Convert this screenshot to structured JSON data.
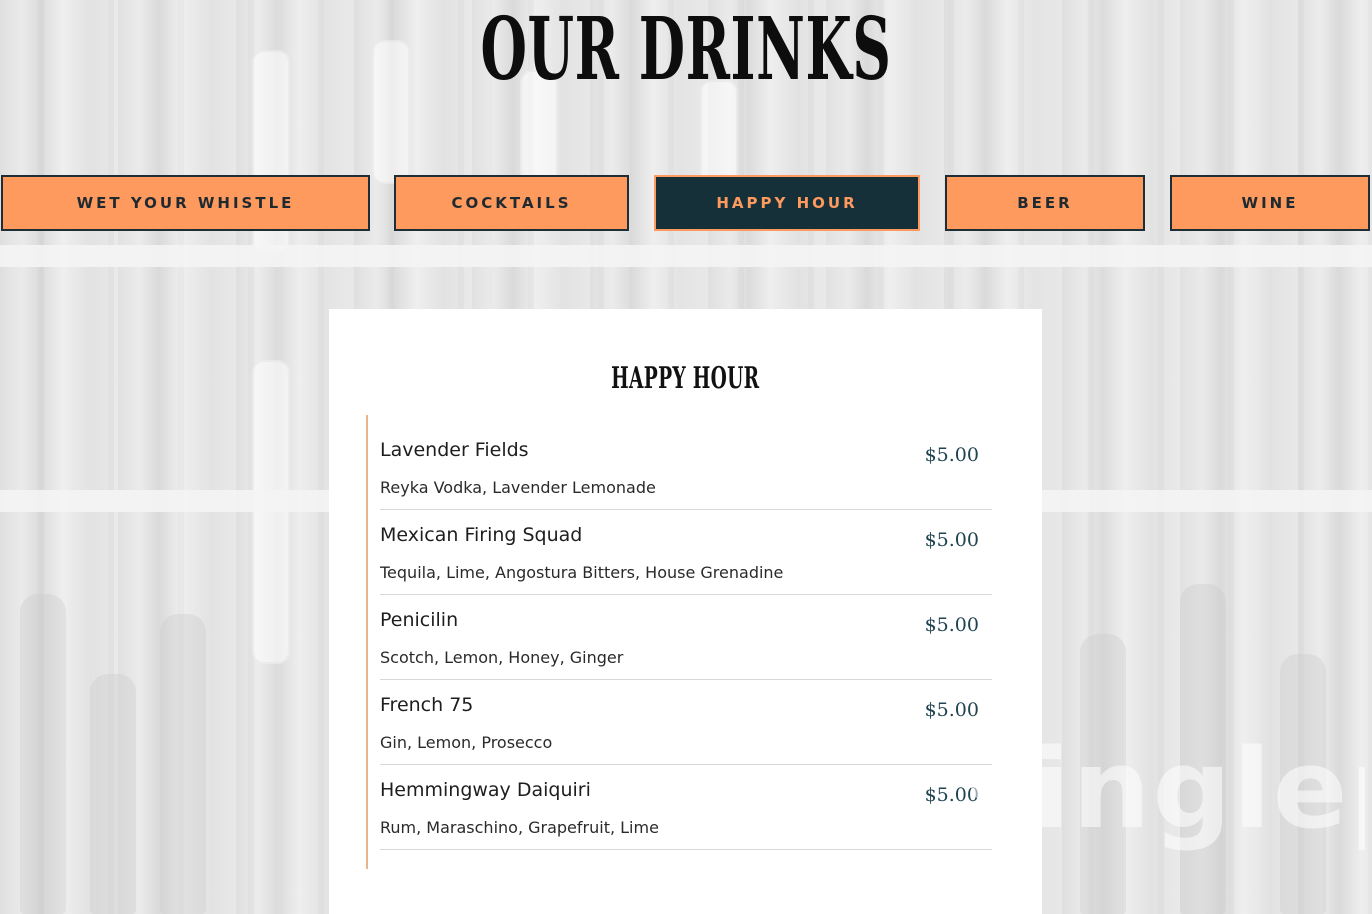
{
  "page": {
    "title": "OUR DRINKS"
  },
  "tabs": [
    {
      "label": "WET YOUR WHISTLE",
      "active": false
    },
    {
      "label": "COCKTAILS",
      "active": false
    },
    {
      "label": "HAPPY HOUR",
      "active": true
    },
    {
      "label": "BEER",
      "active": false
    },
    {
      "label": "WINE",
      "active": false
    }
  ],
  "menu": {
    "section_title": "HAPPY HOUR",
    "items": [
      {
        "name": "Lavender Fields",
        "description": "Reyka Vodka, Lavender Lemonade",
        "price": "$5.00"
      },
      {
        "name": "Mexican Firing Squad",
        "description": "Tequila, Lime, Angostura Bitters, House Grenadine",
        "price": "$5.00"
      },
      {
        "name": "Penicilin",
        "description": "Scotch, Lemon, Honey, Ginger",
        "price": "$5.00"
      },
      {
        "name": "French 75",
        "description": "Gin, Lemon, Prosecco",
        "price": "$5.00"
      },
      {
        "name": "Hemmingway Daiquiri",
        "description": "Rum, Maraschino, Grapefruit, Lime",
        "price": "$5.00"
      }
    ]
  },
  "watermark": "singleplatform",
  "colors": {
    "tab_bg": "#ff9a5e",
    "tab_active_bg": "#16303a",
    "price": "#1f4450",
    "accent_line": "#e6b48d"
  }
}
